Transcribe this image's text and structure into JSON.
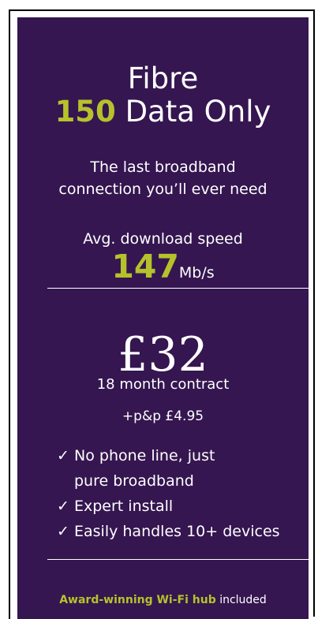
{
  "title": {
    "line1": "Fibre",
    "tier": "150",
    "line2_rest": "Data Only"
  },
  "tagline": {
    "line1": "The last broadband",
    "line2": "connection you’ll ever need"
  },
  "speed": {
    "label": "Avg. download speed",
    "value": "147",
    "unit": "Mb/s"
  },
  "price": {
    "amount": "£32",
    "contract": "18 month contract",
    "postage": "+p&p £4.95"
  },
  "features": {
    "check_glyph": "✓",
    "items": [
      {
        "line1": "No phone line, just",
        "line2": "pure broadband"
      },
      {
        "line1": "Expert install"
      },
      {
        "line1": "Easily handles 10+ devices"
      }
    ]
  },
  "footer": {
    "highlight": "Award-winning Wi-Fi hub",
    "rest": "included"
  },
  "colors": {
    "background": "#351650",
    "accent": "#b6c22b",
    "text": "#ffffff"
  },
  "icons": {
    "feature_bullet": "check-icon"
  }
}
